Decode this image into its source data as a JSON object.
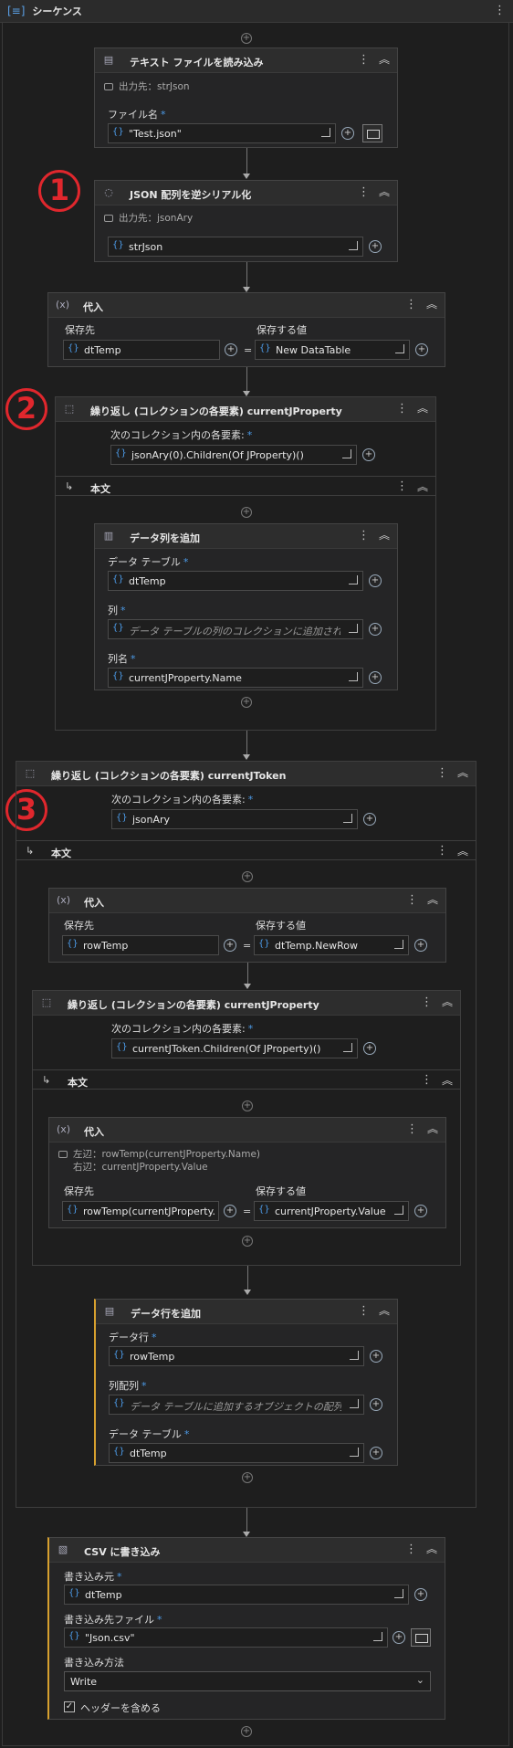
{
  "sequence": {
    "title": "シーケンス"
  },
  "read_text": {
    "title": "テキスト ファイルを読み込み",
    "output": "出力先：strJson",
    "file_label": "ファイル名",
    "file_value": "\"Test.json\""
  },
  "deserialize": {
    "title": "JSON 配列を逆シリアル化",
    "output": "出力先：jsonAry",
    "value": "strJson"
  },
  "assign1": {
    "title": "代入",
    "to_label": "保存先",
    "to_value": "dtTemp",
    "value_label": "保存する値",
    "value_value": "New DataTable"
  },
  "foreach1": {
    "title": "繰り返し (コレクションの各要素) currentJProperty",
    "coll_label": "次のコレクション内の各要素:",
    "coll_value": "jsonAry(0).Children(Of JProperty)()",
    "body_label": "本文"
  },
  "add_col": {
    "title": "データ列を追加",
    "dt_label": "データ テーブル",
    "dt_value": "dtTemp",
    "col_label": "列",
    "col_placeholder": "データ テーブルの列のコレクションに追加される DataColumn オブジェクトです。",
    "name_label": "列名",
    "name_value": "currentJProperty.Name"
  },
  "foreach2": {
    "title": "繰り返し (コレクションの各要素) currentJToken",
    "coll_label": "次のコレクション内の各要素:",
    "coll_value": "jsonAry",
    "body_label": "本文"
  },
  "assign2": {
    "title": "代入",
    "to_label": "保存先",
    "to_value": "rowTemp",
    "value_label": "保存する値",
    "value_value": "dtTemp.NewRow"
  },
  "foreach3": {
    "title": "繰り返し (コレクションの各要素) currentJProperty",
    "coll_label": "次のコレクション内の各要素:",
    "coll_value": "currentJToken.Children(Of JProperty)()",
    "body_label": "本文"
  },
  "assign3": {
    "title": "代入",
    "left_annot": "左辺：rowTemp(currentJProperty.Name)",
    "right_annot": "右辺：currentJProperty.Value",
    "to_label": "保存先",
    "to_value": "rowTemp(currentJProperty.Name)",
    "value_label": "保存する値",
    "value_value": "currentJProperty.Value"
  },
  "add_row": {
    "title": "データ行を追加",
    "row_label": "データ行",
    "row_value": "rowTemp",
    "arr_label": "列配列",
    "arr_placeholder": "データ テーブルに追加するオブジェクトの配列です。",
    "dt_label": "データ テーブル",
    "dt_value": "dtTemp"
  },
  "write_csv": {
    "title": "CSV に書き込み",
    "src_label": "書き込み元",
    "src_value": "dtTemp",
    "file_label": "書き込み先ファイル",
    "file_value": "\"Json.csv\"",
    "mode_label": "書き込み方法",
    "mode_value": "Write",
    "header_label": "ヘッダーを含める"
  },
  "badges": {
    "one": "1",
    "two": "2",
    "three": "3"
  },
  "colors": {
    "accent_blue": "#4c9be8",
    "badge_red": "#e0272d",
    "accent_yellow": "#d7a02e"
  }
}
